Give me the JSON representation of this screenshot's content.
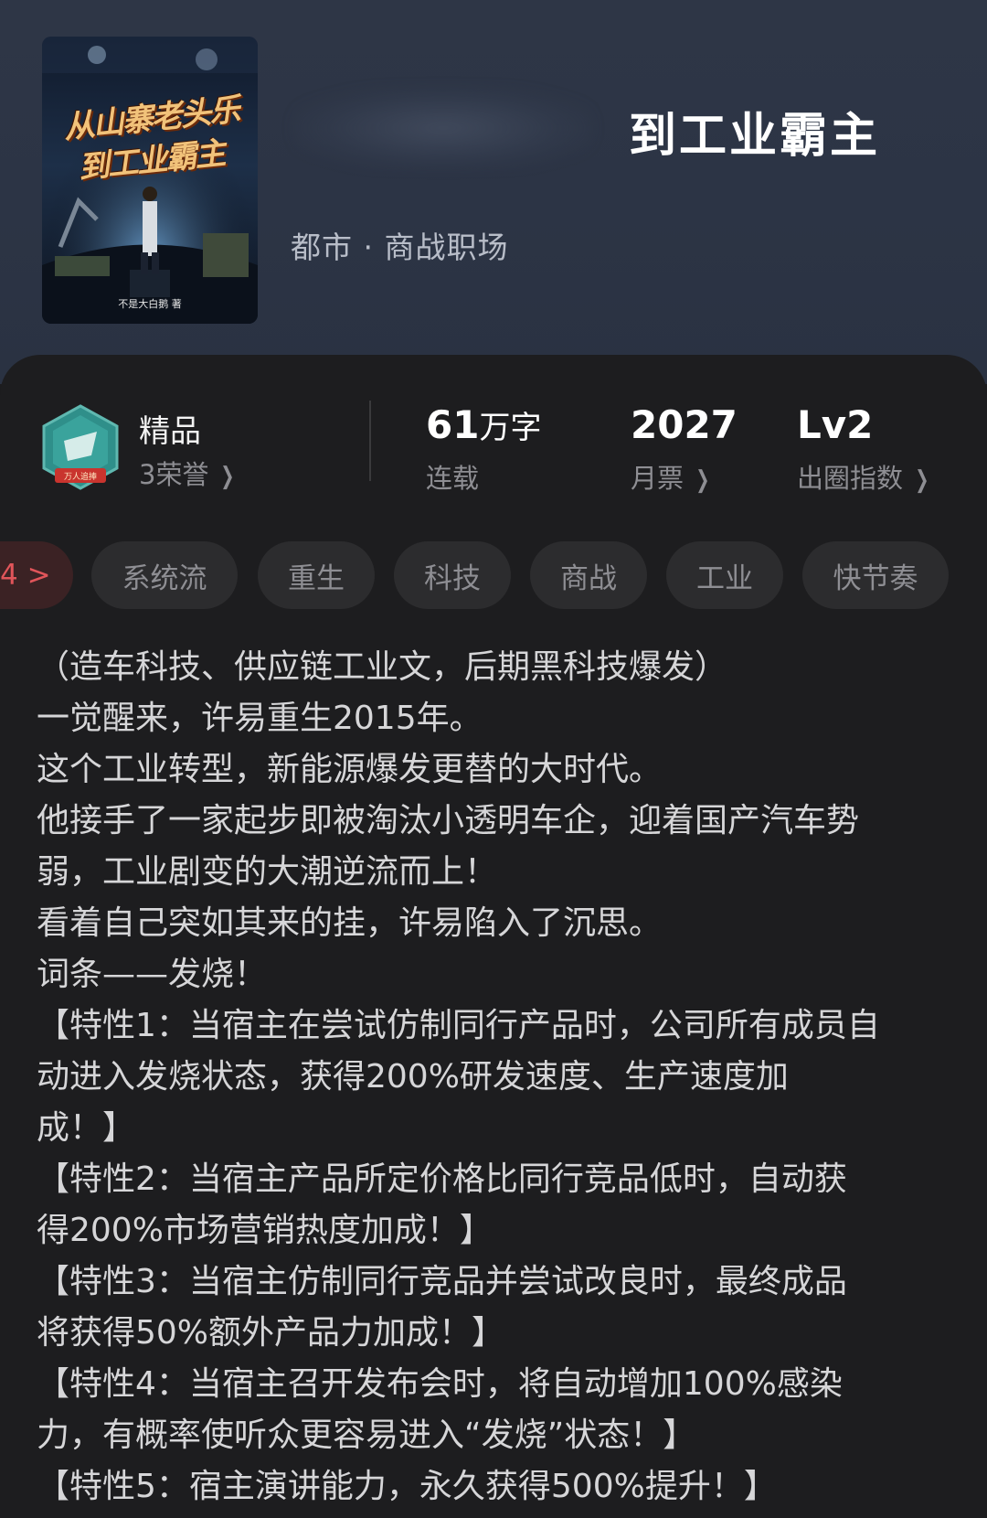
{
  "header": {
    "cover_title_line1": "从山寨老头乐",
    "cover_title_line2": "到工业霸主",
    "cover_author": "不是大白鹅 著",
    "title_visible": "到工业霸主",
    "genre": "都市 · 商战职场"
  },
  "stats": {
    "badge_text": "万人追捧",
    "quality_label": "精品",
    "honor_label": "3荣誉",
    "word_count": "61",
    "word_unit": "万字",
    "status": "连载",
    "monthly_votes": "2027",
    "monthly_votes_label": "月票",
    "level": "Lv2",
    "level_label": "出圈指数"
  },
  "tags": {
    "more_label": "4 >",
    "items": [
      "系统流",
      "重生",
      "科技",
      "商战",
      "工业",
      "快节奏"
    ]
  },
  "description": {
    "lines": [
      "（造车科技、供应链工业文，后期黑科技爆发）",
      "一觉醒来，许易重生2015年。",
      "这个工业转型，新能源爆发更替的大时代。",
      "他接手了一家起步即被淘汰小透明车企，迎着国产汽车势",
      "弱，工业剧变的大潮逆流而上！",
      "看着自己突如其来的挂，许易陷入了沉思。",
      "词条——发烧！",
      "【特性1：当宿主在尝试仿制同行产品时，公司所有成员自",
      "动进入发烧状态，获得200%研发速度、生产速度加",
      "成！】",
      "【特性2：当宿主产品所定价格比同行竞品低时，自动获",
      "得200%市场营销热度加成！】",
      "【特性3：当宿主仿制同行竞品并尝试改良时，最终成品",
      "将获得50%额外产品力加成！】",
      "【特性4：当宿主召开发布会时，将自动增加100%感染",
      "力，有概率使听众更容易进入“发烧”状态！】",
      "【特性5：宿主演讲能力，永久获得500%提升！】"
    ]
  }
}
